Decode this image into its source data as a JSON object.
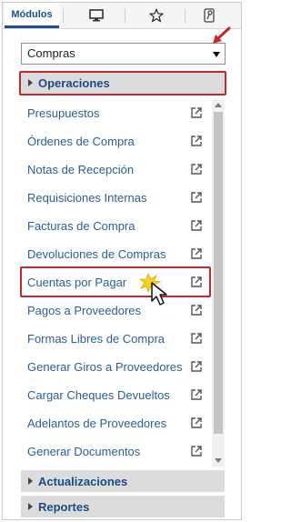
{
  "tabs": {
    "modulos_label": "Módulos",
    "icons": [
      "desktop-icon",
      "star-icon",
      "key-icon"
    ]
  },
  "module_select": {
    "value": "Compras"
  },
  "sections": {
    "operaciones": "Operaciones",
    "actualizaciones": "Actualizaciones",
    "reportes": "Reportes"
  },
  "items": [
    {
      "label": "Presupuestos"
    },
    {
      "label": "Órdenes de Compra"
    },
    {
      "label": "Notas de Recepción"
    },
    {
      "label": "Requisiciones Internas"
    },
    {
      "label": "Facturas de Compra"
    },
    {
      "label": "Devoluciones de Compras"
    },
    {
      "label": "Cuentas por Pagar"
    },
    {
      "label": "Pagos a Proveedores"
    },
    {
      "label": "Formas Libres de Compra"
    },
    {
      "label": "Generar Giros a Proveedores"
    },
    {
      "label": "Cargar Cheques Devueltos"
    },
    {
      "label": "Adelantos de Proveedores"
    },
    {
      "label": "Generar Documentos"
    }
  ],
  "colors": {
    "accent": "#1a4f8c",
    "link": "#2a5f94",
    "highlight": "#c0292f"
  }
}
